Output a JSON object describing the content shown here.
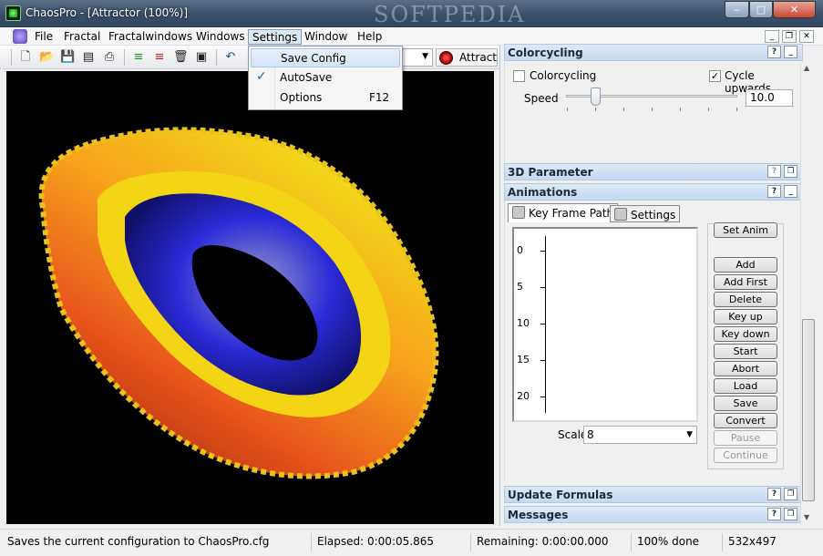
{
  "window": {
    "title": "ChaosPro - [Attractor (100%)]",
    "watermark": "SOFTPEDIA",
    "caption_buttons": {
      "minimize": "‒",
      "maximize": "□",
      "close": "✕"
    }
  },
  "menubar": {
    "items": [
      "File",
      "Fractal",
      "Fractalwindows",
      "Windows",
      "Settings",
      "Window",
      "Help"
    ],
    "active": "Settings"
  },
  "settings_menu": {
    "items": [
      {
        "label": "Save Config",
        "shortcut": "",
        "checked": false
      },
      {
        "label": "AutoSave",
        "shortcut": "",
        "checked": true
      },
      {
        "label": "Options",
        "shortcut": "F12",
        "checked": false
      }
    ]
  },
  "toolbar": {
    "icons": [
      "new-icon",
      "open-icon",
      "save-icon",
      "save-all-icon",
      "print-icon",
      "layers-green-icon",
      "layers-red-icon",
      "delete-icon",
      "window-icon",
      "undo-icon"
    ],
    "attractor_button": "Attractor"
  },
  "colorcycling": {
    "title": "Colorcycling",
    "checkbox_label": "Colorcycling",
    "checkbox_checked": false,
    "cycle_label": "Cycle upwards",
    "cycle_checked": true,
    "speed_label": "Speed",
    "speed_value": "10.0"
  },
  "panels": {
    "parameter_3d": "3D Parameter",
    "animations": "Animations",
    "update_formulas": "Update Formulas",
    "messages": "Messages"
  },
  "animations": {
    "tabs": [
      "Key Frame Path",
      "Settings"
    ],
    "active_tab": "Key Frame Path",
    "axis_labels": [
      "0",
      "5",
      "10",
      "15",
      "20"
    ],
    "set_anim": "Set Anim",
    "buttons": [
      {
        "label": "Add",
        "enabled": true
      },
      {
        "label": "Add First",
        "enabled": true
      },
      {
        "label": "Delete",
        "enabled": true
      },
      {
        "label": "Key up",
        "enabled": true
      },
      {
        "label": "Key down",
        "enabled": true
      },
      {
        "label": "Start",
        "enabled": true
      },
      {
        "label": "Abort",
        "enabled": true
      },
      {
        "label": "Load",
        "enabled": true
      },
      {
        "label": "Save",
        "enabled": true
      },
      {
        "label": "Convert",
        "enabled": true
      },
      {
        "label": "Pause",
        "enabled": false
      },
      {
        "label": "Continue",
        "enabled": false
      }
    ],
    "scale_label": "Scale",
    "scale_value": "8"
  },
  "statusbar": {
    "message": "Saves the current configuration to ChaosPro.cfg",
    "elapsed": "Elapsed: 0:00:05.865",
    "remaining": "Remaining: 0:00:00.000",
    "progress": "100% done",
    "size": "532x497"
  },
  "colors": {
    "panel_header": "#c6d9ef",
    "canvas_bg": "#000000",
    "torus_outer": "#e8541c",
    "torus_mid": "#f2e21a",
    "torus_inner": "#2a2ad8"
  }
}
